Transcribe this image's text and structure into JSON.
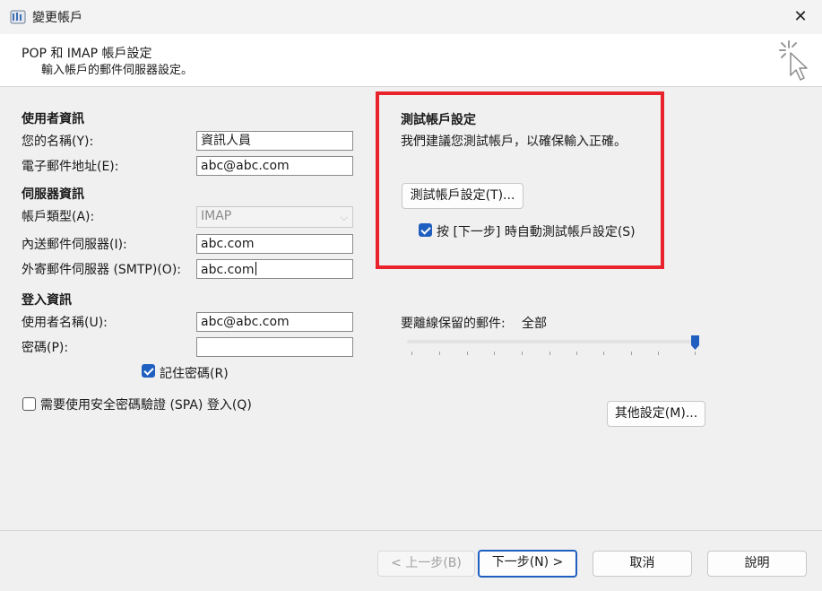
{
  "window": {
    "title": "變更帳戶",
    "close_glyph": "✕"
  },
  "header": {
    "title": "POP 和 IMAP 帳戶設定",
    "subtitle": "輸入帳戶的郵件伺服器設定。",
    "icon": "cursor-click-icon"
  },
  "user_info": {
    "heading": "使用者資訊",
    "name_label": "您的名稱(Y):",
    "name_value": "資訊人員",
    "email_label": "電子郵件地址(E):",
    "email_value": "abc@abc.com"
  },
  "server_info": {
    "heading": "伺服器資訊",
    "account_type_label": "帳戶類型(A):",
    "account_type_value": "IMAP",
    "incoming_label": "內送郵件伺服器(I):",
    "incoming_value": "abc.com",
    "outgoing_label": "外寄郵件伺服器 (SMTP)(O):",
    "outgoing_value": "abc.com"
  },
  "login_info": {
    "heading": "登入資訊",
    "username_label": "使用者名稱(U):",
    "username_value": "abc@abc.com",
    "password_label": "密碼(P):",
    "password_value": "",
    "remember_label": "記住密碼(R)",
    "remember_checked": true,
    "spa_label": "需要使用安全密碼驗證 (SPA) 登入(Q)",
    "spa_checked": false
  },
  "test_settings": {
    "heading": "測試帳戶設定",
    "description": "我們建議您測試帳戶，以確保輸入正確。",
    "test_button": "測試帳戶設定(T)...",
    "auto_test_label": "按 [下一步] 時自動測試帳戶設定(S)",
    "auto_test_checked": true
  },
  "offline": {
    "label": "要離線保留的郵件:",
    "value": "全部",
    "slider_level": 1.0
  },
  "more_settings_button": "其他設定(M)...",
  "footer": {
    "back": "< 上一步(B)",
    "next": "下一步(N) >",
    "cancel": "取消",
    "help": "說明"
  },
  "colors": {
    "accent": "#1f5fbf",
    "highlight_box": "#e8232b"
  }
}
